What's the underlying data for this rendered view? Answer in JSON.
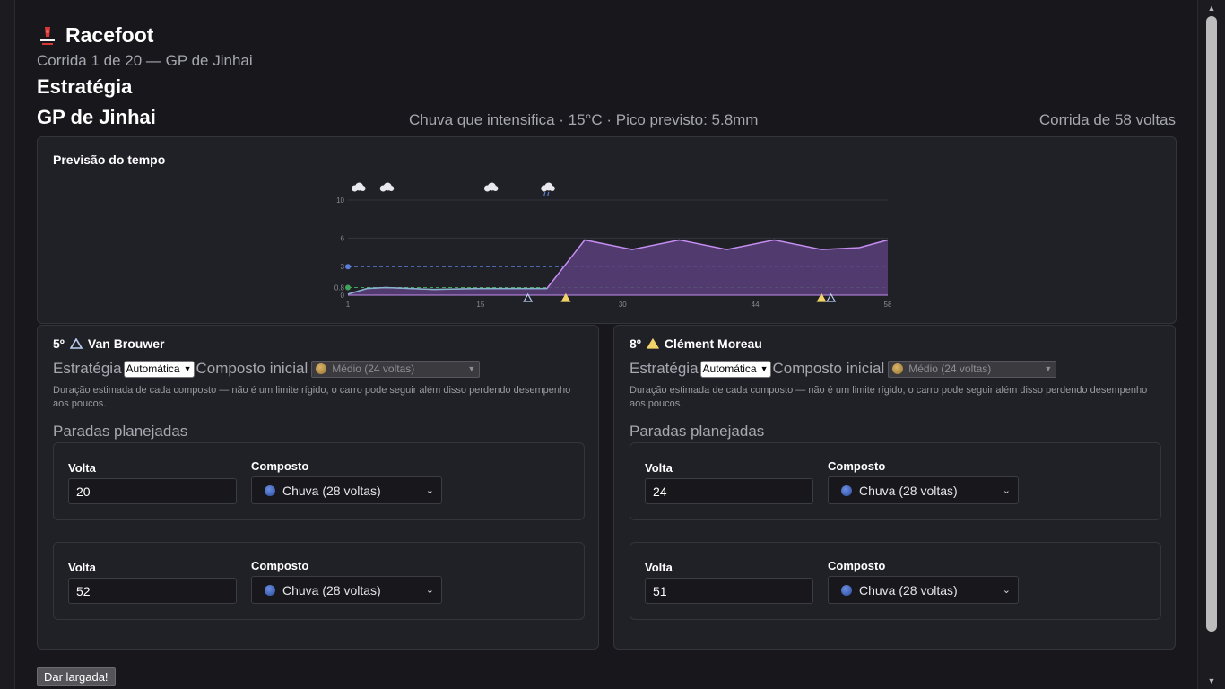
{
  "app": {
    "title": "Racefoot",
    "subtitle": "Corrida 1 de 20 — GP de Jinhai",
    "section": "Estratégia"
  },
  "gp": {
    "name": "GP de Jinhai",
    "weather": "Chuva que intensifica · 15°C · Pico previsto: 5.8mm",
    "laps_text": "Corrida de 58 voltas"
  },
  "forecast": {
    "title": "Previsão do tempo"
  },
  "chart_data": {
    "type": "area",
    "title": "Previsão do tempo",
    "x_ticks": [
      1,
      15,
      30,
      44,
      58
    ],
    "y_ticks": [
      0,
      0.8,
      3,
      6,
      10
    ],
    "xlim": [
      1,
      58
    ],
    "ylim": [
      0,
      10
    ],
    "grid": true,
    "thresholds": [
      {
        "value": 3,
        "color": "#5b7fd8"
      },
      {
        "value": 0.8,
        "color": "#3fa45a"
      }
    ],
    "series": [
      {
        "x": [
          1,
          3,
          5,
          10,
          15,
          20,
          22,
          26,
          31,
          36,
          41,
          46,
          51,
          55,
          58
        ],
        "values": [
          0.1,
          0.7,
          0.8,
          0.6,
          0.7,
          0.7,
          0.7,
          5.8,
          4.8,
          5.8,
          4.8,
          5.8,
          4.8,
          5.0,
          5.8
        ]
      }
    ],
    "weather_icons": [
      {
        "x": 2,
        "icon": "cloud-icon"
      },
      {
        "x": 5,
        "icon": "cloud-icon"
      },
      {
        "x": 16,
        "icon": "cloud-icon"
      },
      {
        "x": 22,
        "icon": "rain-cloud-icon"
      }
    ],
    "pit_markers": [
      {
        "x": 20,
        "driver": "Van Brouwer",
        "color": "#bcd0f5"
      },
      {
        "x": 24,
        "driver": "Clément Moreau",
        "color": "#f2d36a"
      },
      {
        "x": 51,
        "driver": "Clément Moreau",
        "color": "#f2d36a"
      },
      {
        "x": 52,
        "driver": "Van Brouwer",
        "color": "#bcd0f5"
      }
    ]
  },
  "labels": {
    "strategy": "Estratégia",
    "compound_initial": "Composto inicial",
    "hint": "Duração estimada de cada composto — não é um limite rígido, o carro pode seguir além disso perdendo desempenho aos poucos.",
    "stops_title": "Paradas planejadas",
    "lap": "Volta",
    "compound": "Composto"
  },
  "drivers": [
    {
      "position": "5º",
      "name": "Van Brouwer",
      "strategy": "Automática",
      "initial_compound": "Médio (24 voltas)",
      "marker_color": "#bcd0f5",
      "stops": [
        {
          "lap": "20",
          "compound": "Chuva (28 voltas)"
        },
        {
          "lap": "52",
          "compound": "Chuva (28 voltas)"
        }
      ]
    },
    {
      "position": "8º",
      "name": "Clément Moreau",
      "strategy": "Automática",
      "initial_compound": "Médio (24 voltas)",
      "marker_color": "#f2d36a",
      "stops": [
        {
          "lap": "24",
          "compound": "Chuva (28 voltas)"
        },
        {
          "lap": "51",
          "compound": "Chuva (28 voltas)"
        }
      ]
    }
  ],
  "start_button": "Dar largada!",
  "colors": {
    "area_line": "#c48ef0",
    "area_fill": "#5a3f7a",
    "background": "#17171c",
    "card": "#202027"
  }
}
